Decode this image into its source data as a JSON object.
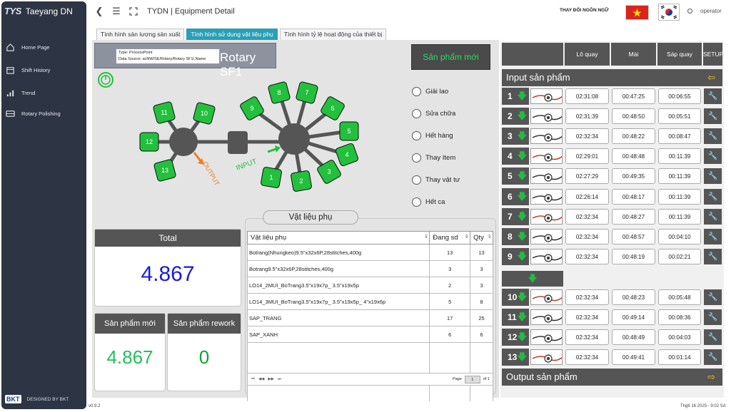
{
  "sidebar": {
    "logo": "TYS",
    "name": "Taeyang DN",
    "items": [
      {
        "label": "Home Page",
        "icon": "home-icon"
      },
      {
        "label": "Shift History",
        "icon": "calendar-icon"
      },
      {
        "label": "Trend",
        "icon": "bar-chart-icon"
      },
      {
        "label": "Rotary Polishing",
        "icon": "machine-icon"
      }
    ],
    "designed_by": "DESIGNED BY BKT",
    "bkt_logo": "BKT"
  },
  "topbar": {
    "title": "TYDN | Equipment Detail",
    "language_label": "THAY ĐỔI NGÔN NGỮ",
    "user": "operator"
  },
  "tabs": [
    {
      "label": "Tình hình sản lượng sản xuất",
      "active": false
    },
    {
      "label": "Tình hình sử dụng vật liệu phụ",
      "active": true
    },
    {
      "label": "Tình hình tỷ lệ hoạt động của thiết bị",
      "active": false
    }
  ],
  "machine": {
    "title": "Rotary SF1",
    "tooltip_line1": "Type: ProcessPoint",
    "tooltip_line2": "Data Source: acNW/SE/Rotary/Rotary SF1/.Name",
    "new_product_button": "Sản phẩm mới",
    "output_label": "OUTPUT",
    "input_label": "INPUT",
    "left_stations": [
      "11",
      "10",
      "12",
      "13"
    ],
    "right_stations": [
      "8",
      "7",
      "9",
      "6",
      "5",
      "4",
      "3",
      "2",
      "1"
    ]
  },
  "status_options": [
    "Giải lao",
    "Sửa chữa",
    "Hết hàng",
    "Thay Item",
    "Thay vật tư",
    "Hết ca"
  ],
  "total": {
    "label": "Total",
    "value": "4.867"
  },
  "new_products": {
    "label": "Sản phẩm mới",
    "value": "4.867"
  },
  "rework": {
    "label": "Sản phẩm rework",
    "value": "0"
  },
  "materials": {
    "title": "Vật liệu phụ",
    "headers": [
      "Vật liệu phụ",
      "Đang sd",
      "Qty"
    ],
    "rows": [
      {
        "name": "Botrang(Nhungkeo)9.5\"x32x6P,28stitches,400g",
        "used": "13",
        "qty": "13"
      },
      {
        "name": "Botrang9.5\"x32x6P,28stitches,400g",
        "used": "3",
        "qty": "3"
      },
      {
        "name": "LO14_2MUI_BoTrang3.5\"x19x7p_ 3.5\"x19x5p",
        "used": "2",
        "qty": "3"
      },
      {
        "name": "LO14_3MUI_BoTrang3.5\"x19x7p_ 3.5\"x19x5p_ 4\"x19x6p",
        "used": "5",
        "qty": "8"
      },
      {
        "name": "SAP_TRANG",
        "used": "17",
        "qty": "25"
      },
      {
        "name": "SAP_XANH",
        "used": "6",
        "qty": "6"
      }
    ],
    "pager": {
      "page_label": "Page",
      "page_value": "1",
      "of_label": "of 1"
    }
  },
  "right_panel": {
    "headers": [
      "Lô quay",
      "Mài",
      "Sáp quay",
      "SETUP"
    ],
    "input_label": "Input sản phẩm",
    "output_label": "Output sản phẩm",
    "rows": [
      {
        "no": "1",
        "lo": "02:31:08",
        "mai": "00:47:25",
        "sap": "00:06:55"
      },
      {
        "no": "2",
        "lo": "02:31:39",
        "mai": "00:48:50",
        "sap": "00:05:51"
      },
      {
        "no": "3",
        "lo": "02:32:34",
        "mai": "00:48:22",
        "sap": "00:08:47"
      },
      {
        "no": "4",
        "lo": "02:29:01",
        "mai": "00:48:48",
        "sap": "00:11:39"
      },
      {
        "no": "5",
        "lo": "02:27:29",
        "mai": "00:49:35",
        "sap": "00:11:39"
      },
      {
        "no": "6",
        "lo": "02:26:14",
        "mai": "00:48:17",
        "sap": "00:11:39"
      },
      {
        "no": "7",
        "lo": "02:32:34",
        "mai": "00:48:27",
        "sap": "00:11:39"
      },
      {
        "no": "8",
        "lo": "02:32:34",
        "mai": "00:48:57",
        "sap": "00:04:10"
      },
      {
        "no": "9",
        "lo": "02:32:34",
        "mai": "00:48:19",
        "sap": "00:02:21"
      },
      {
        "no": "10",
        "lo": "02:32:34",
        "mai": "00:48:23",
        "sap": "00:05:48"
      },
      {
        "no": "11",
        "lo": "02:32:34",
        "mai": "00:49:14",
        "sap": "00:08:36"
      },
      {
        "no": "12",
        "lo": "02:32:34",
        "mai": "00:48:49",
        "sap": "00:04:03"
      },
      {
        "no": "13",
        "lo": "02:32:34",
        "mai": "00:49:41",
        "sap": "00:01:14"
      }
    ]
  },
  "footer": {
    "version": "v0.9.2",
    "datetime": "Thg6 16 2025 - 9:02 SA"
  },
  "colors": {
    "sidebar": "#2d3443",
    "accent_tab": "#2a9fb5",
    "station_green": "#22c03c",
    "total_blue": "#1a1add",
    "output_orange": "#f07c1a",
    "arrow_yellow": "#f3c21a"
  }
}
